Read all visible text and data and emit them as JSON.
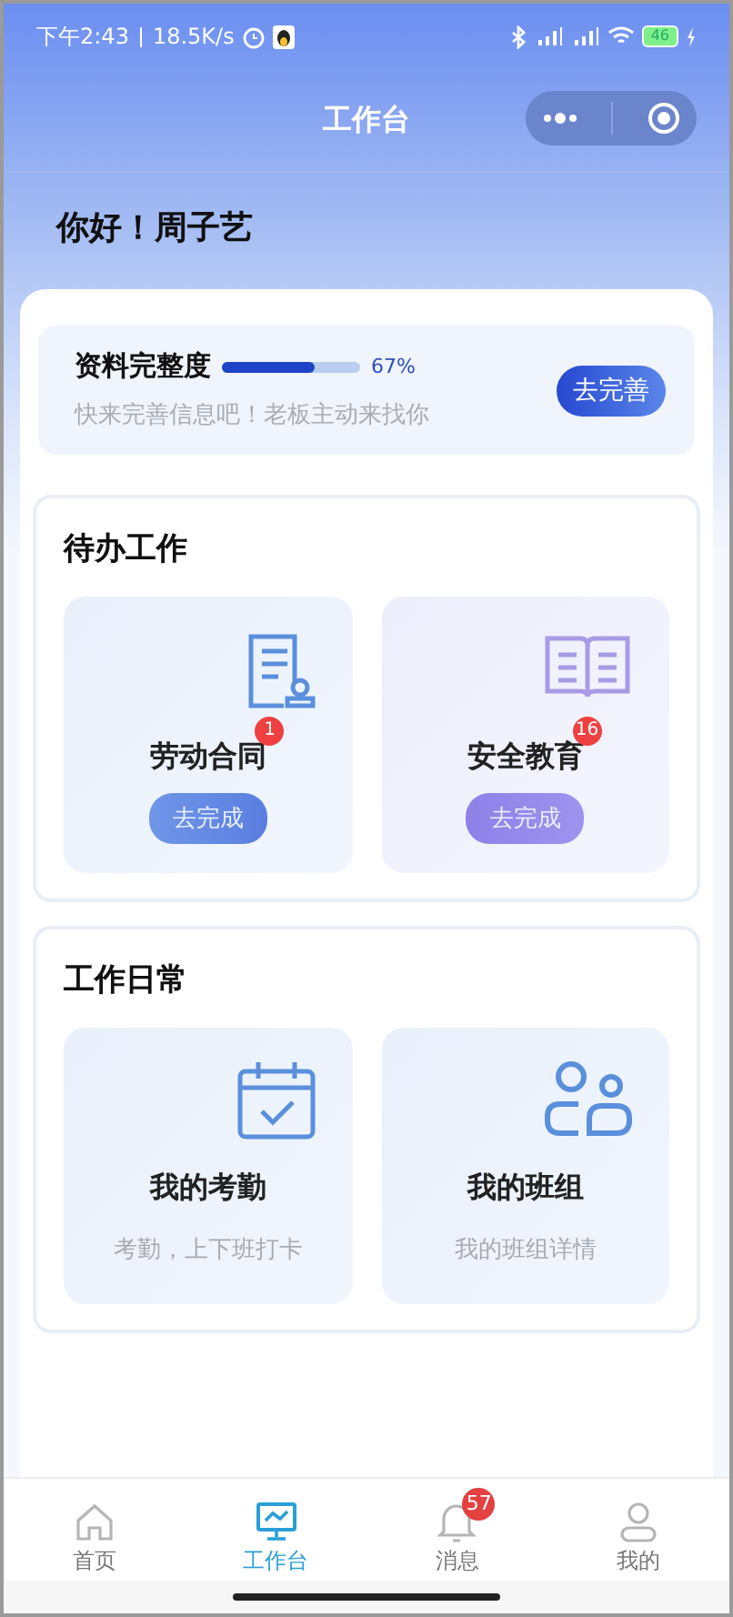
{
  "status_bar": {
    "time": "下午2:43",
    "speed": "18.5K/s",
    "battery": "46"
  },
  "nav": {
    "title": "工作台"
  },
  "greeting": "你好！周子艺",
  "profile": {
    "title": "资料完整度",
    "level": 0.67,
    "percent": "67%",
    "hint": "快来完善信息吧！老板主动来找你",
    "button": "去完善"
  },
  "todo": {
    "title": "待办工作",
    "items": [
      {
        "kind": "contract",
        "label": "劳动合同",
        "badge": "1",
        "button": "去完成"
      },
      {
        "kind": "book",
        "label": "安全教育",
        "badge": "16",
        "button": "去完成"
      }
    ]
  },
  "daily": {
    "title": "工作日常",
    "items": [
      {
        "kind": "calendar",
        "label": "我的考勤",
        "subtitle": "考勤，上下班打卡"
      },
      {
        "kind": "team",
        "label": "我的班组",
        "subtitle": "我的班组详情"
      }
    ]
  },
  "tab_bar": [
    {
      "kind": "home",
      "label": "首页",
      "selected": false
    },
    {
      "kind": "monitor",
      "label": "工作台",
      "selected": true
    },
    {
      "kind": "bell",
      "label": "消息",
      "selected": false,
      "badge": "57"
    },
    {
      "kind": "user",
      "label": "我的",
      "selected": false
    }
  ]
}
